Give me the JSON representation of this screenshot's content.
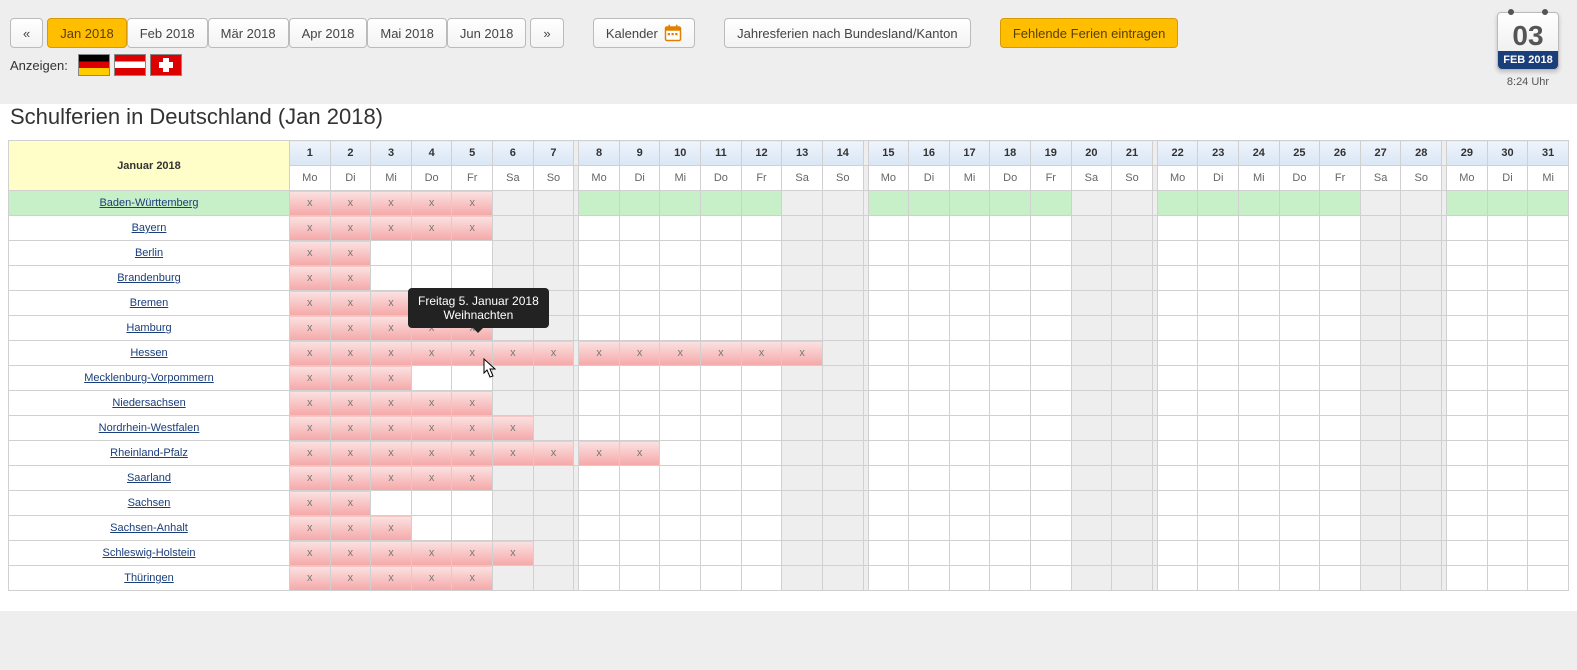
{
  "nav": {
    "prev": "«",
    "next": "»",
    "months": [
      "Jan 2018",
      "Feb 2018",
      "Mär 2018",
      "Apr 2018",
      "Mai 2018",
      "Jun 2018"
    ],
    "active": 0,
    "btn_calendar": "Kalender",
    "btn_year": "Jahresferien nach Bundesland/Kanton",
    "btn_missing": "Fehlende Ferien eintragen"
  },
  "show_label": "Anzeigen:",
  "tearoff": {
    "day": "03",
    "month": "FEB 2018",
    "time": "8:24 Uhr"
  },
  "title": "Schulferien in Deutschland (Jan 2018)",
  "month_label": "Januar 2018",
  "tooltip": {
    "line1": "Freitag 5. Januar 2018",
    "line2": "Weihnachten"
  },
  "days": [
    1,
    2,
    3,
    4,
    5,
    6,
    7,
    8,
    9,
    10,
    11,
    12,
    13,
    14,
    15,
    16,
    17,
    18,
    19,
    20,
    21,
    22,
    23,
    24,
    25,
    26,
    27,
    28,
    29,
    30,
    31
  ],
  "dow": [
    "Mo",
    "Di",
    "Mi",
    "Do",
    "Fr",
    "Sa",
    "So",
    "Mo",
    "Di",
    "Mi",
    "Do",
    "Fr",
    "Sa",
    "So",
    "Mo",
    "Di",
    "Mi",
    "Do",
    "Fr",
    "Sa",
    "So",
    "Mo",
    "Di",
    "Mi",
    "Do",
    "Fr",
    "Sa",
    "So",
    "Mo",
    "Di",
    "Mi"
  ],
  "week_start_idx": [
    0,
    7,
    14,
    21,
    28
  ],
  "states": [
    {
      "name": "Baden-Württemberg",
      "hl": true,
      "x": [
        1,
        2,
        3,
        4,
        5
      ]
    },
    {
      "name": "Bayern",
      "x": [
        1,
        2,
        3,
        4,
        5
      ]
    },
    {
      "name": "Berlin",
      "x": [
        1,
        2
      ]
    },
    {
      "name": "Brandenburg",
      "x": [
        1,
        2
      ]
    },
    {
      "name": "Bremen",
      "x": [
        1,
        2,
        3,
        4,
        5,
        6
      ]
    },
    {
      "name": "Hamburg",
      "x": [
        1,
        2,
        3,
        4,
        5
      ]
    },
    {
      "name": "Hessen",
      "x": [
        1,
        2,
        3,
        4,
        5,
        6,
        7,
        8,
        9,
        10,
        11,
        12,
        13
      ]
    },
    {
      "name": "Mecklenburg-Vorpommern",
      "x": [
        1,
        2,
        3
      ]
    },
    {
      "name": "Niedersachsen",
      "x": [
        1,
        2,
        3,
        4,
        5
      ]
    },
    {
      "name": "Nordrhein-Westfalen",
      "x": [
        1,
        2,
        3,
        4,
        5,
        6
      ]
    },
    {
      "name": "Rheinland-Pfalz",
      "x": [
        1,
        2,
        3,
        4,
        5,
        6,
        7,
        8,
        9
      ]
    },
    {
      "name": "Saarland",
      "x": [
        1,
        2,
        3,
        4,
        5
      ]
    },
    {
      "name": "Sachsen",
      "x": [
        1,
        2
      ]
    },
    {
      "name": "Sachsen-Anhalt",
      "x": [
        1,
        2,
        3
      ]
    },
    {
      "name": "Schleswig-Holstein",
      "x": [
        1,
        2,
        3,
        4,
        5,
        6
      ]
    },
    {
      "name": "Thüringen",
      "x": [
        1,
        2,
        3,
        4,
        5
      ]
    }
  ]
}
